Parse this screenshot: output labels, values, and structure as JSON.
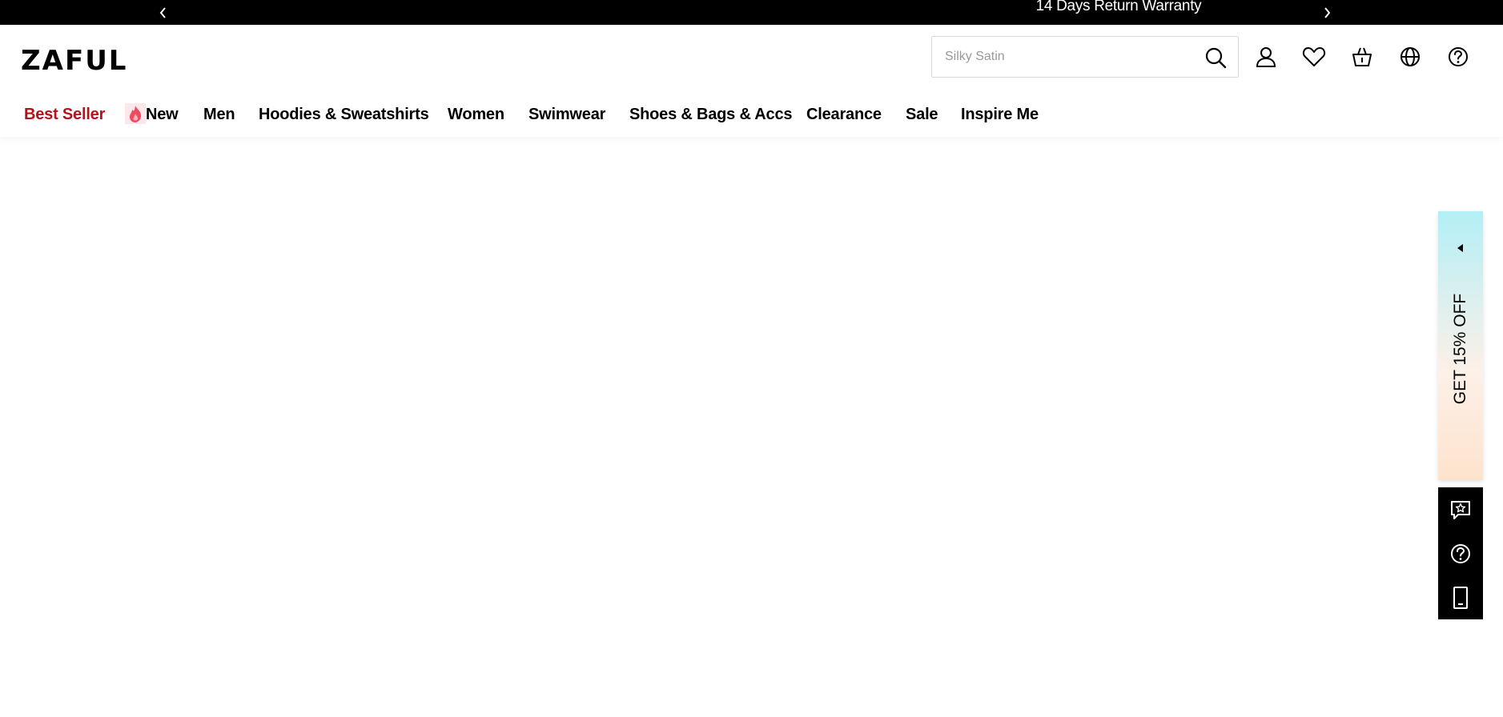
{
  "promo_bar": {
    "message": "14 Days Return Warranty",
    "prev_icon": "chevron-left-icon",
    "next_icon": "chevron-right-icon"
  },
  "header": {
    "logo": "ZAFUL",
    "search": {
      "placeholder": "Silky Satin",
      "icon": "search-icon"
    },
    "icons": [
      "account-icon",
      "wishlist-heart-icon",
      "cart-basket-icon",
      "language-globe-icon",
      "help-question-icon"
    ]
  },
  "nav": {
    "items": [
      {
        "label": "Best Seller",
        "hot": true,
        "icon": "flame-icon"
      },
      {
        "label": "New"
      },
      {
        "label": "Men"
      },
      {
        "label": "Hoodies & Sweatshirts"
      },
      {
        "label": "Women"
      },
      {
        "label": "Swimwear"
      },
      {
        "label": "Shoes & Bags & Accs"
      },
      {
        "label": "Clearance"
      },
      {
        "label": "Sale"
      },
      {
        "label": "Inspire Me"
      }
    ]
  },
  "side_promo": {
    "label": "GET 15% OFF",
    "icon": "triangle-left-icon"
  },
  "side_tools": [
    "feedback-star-icon",
    "help-question-icon",
    "mobile-app-icon"
  ],
  "colors": {
    "hot": "#b5121b",
    "promo_bar_bg": "#000000",
    "side_promo_top": "#b3eff6",
    "side_promo_bottom": "#fde3cc"
  }
}
